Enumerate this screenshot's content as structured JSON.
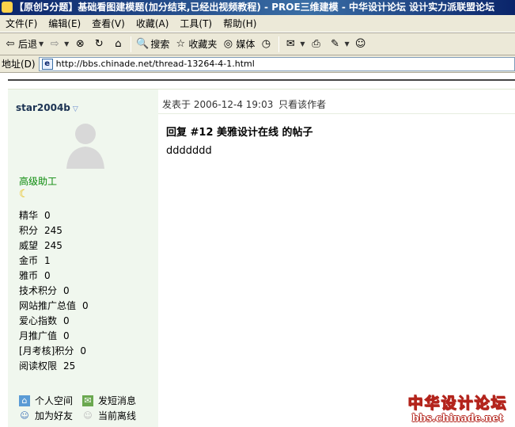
{
  "window": {
    "title": "【原创5分题】基础看图建模题(加分结束,已经出视频教程) - PROE三维建模 - 中华设计论坛 设计实力派联盟论坛"
  },
  "menu": [
    "文件(F)",
    "编辑(E)",
    "查看(V)",
    "收藏(A)",
    "工具(T)",
    "帮助(H)"
  ],
  "toolbar": {
    "back": "后退",
    "search": "搜索",
    "favorites": "收藏夹",
    "media": "媒体"
  },
  "address": {
    "label": "地址(D)",
    "url": "http://bbs.chinade.net/thread-13264-4-1.html"
  },
  "post": {
    "author": "star2004b",
    "grade": "高级助工",
    "stats": [
      {
        "label": "精华",
        "value": "0"
      },
      {
        "label": "积分",
        "value": "245"
      },
      {
        "label": "威望",
        "value": "245"
      },
      {
        "label": "金币",
        "value": "1"
      },
      {
        "label": "雅币",
        "value": "0"
      },
      {
        "label": "技术积分",
        "value": "0"
      },
      {
        "label": "网站推广总值",
        "value": "0"
      },
      {
        "label": "爱心指数",
        "value": "0"
      },
      {
        "label": "月推广值",
        "value": "0"
      },
      {
        "label": "[月考核]积分",
        "value": "0"
      },
      {
        "label": "阅读权限",
        "value": "25"
      }
    ],
    "actions": {
      "space": "个人空间",
      "message": "发短消息",
      "add_friend": "加为好友",
      "status": "当前离线"
    },
    "meta_prefix": "发表于",
    "date": "2006-12-4 19:03",
    "only_author": "只看该作者",
    "title": "回复 #12 美雅设计在线 的帖子",
    "body": "ddddddd"
  },
  "watermark": {
    "name": "中华设计论坛",
    "url": "bbs.chinade.net"
  }
}
